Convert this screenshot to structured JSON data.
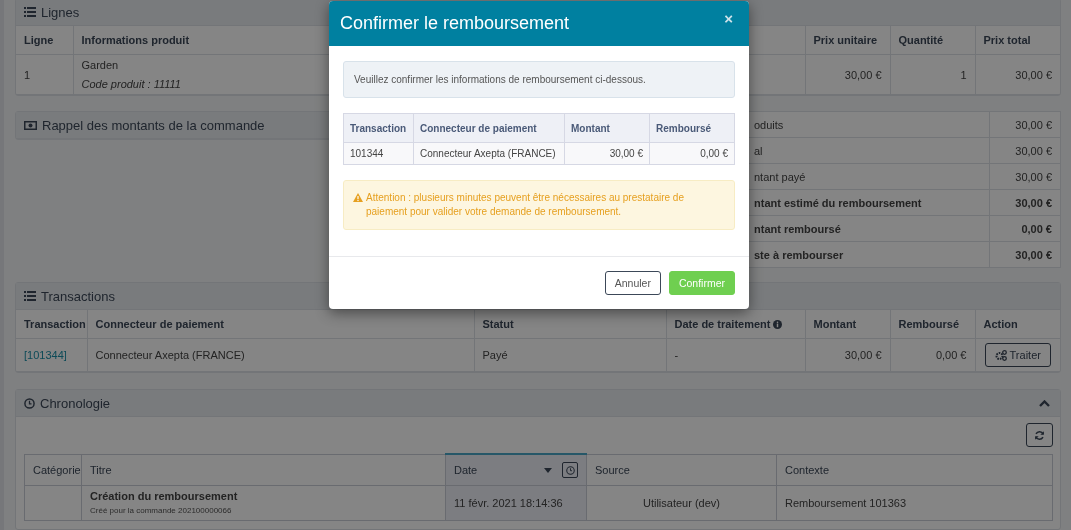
{
  "lignes": {
    "title": "Lignes",
    "columns": [
      {
        "label": "Ligne"
      },
      {
        "label": "Informations produit"
      },
      {
        "label": "Prix unitaire"
      },
      {
        "label": "Quantité"
      },
      {
        "label": "Prix total"
      }
    ],
    "rows": [
      {
        "line": "1",
        "product": "Garden",
        "code": "Code produit : 11111",
        "unit_price": "30,00 €",
        "quantity": "1",
        "total": "30,00 €"
      }
    ]
  },
  "rappel": {
    "title": "Rappel des montants de la commande",
    "rows": [
      {
        "label": "oduits",
        "value": "30,00 €",
        "bold": false
      },
      {
        "label": "al",
        "value": "30,00 €",
        "bold": false
      },
      {
        "label": "ntant payé",
        "value": "30,00 €",
        "bold": false
      },
      {
        "label": "ntant estimé du remboursement",
        "value": "30,00 €",
        "bold": true
      },
      {
        "label": "ntant remboursé",
        "value": "0,00 €",
        "bold": true
      },
      {
        "label": "ste à rembourser",
        "value": "30,00 €",
        "bold": true
      }
    ]
  },
  "transactions": {
    "title": "Transactions",
    "columns": [
      {
        "label": "Transaction",
        "info": false
      },
      {
        "label": "Connecteur de paiement",
        "info": false
      },
      {
        "label": "Statut",
        "info": false
      },
      {
        "label": "Date de traitement",
        "info": true
      },
      {
        "label": "Montant",
        "info": false
      },
      {
        "label": "Remboursé",
        "info": false
      },
      {
        "label": "Action",
        "info": false
      }
    ],
    "rows": [
      {
        "transaction": "[101344]",
        "connector": "Connecteur Axepta (FRANCE)",
        "status": "Payé",
        "date": "-",
        "amount": "30,00 €",
        "refunded": "0,00 €",
        "action": "Traiter"
      }
    ]
  },
  "chronologie": {
    "title": "Chronologie",
    "expanded": true,
    "columns": [
      {
        "label": "Catégorie",
        "sorted": false
      },
      {
        "label": "Titre",
        "sorted": false
      },
      {
        "label": "Date",
        "sorted": true
      },
      {
        "label": "Source",
        "sorted": false
      },
      {
        "label": "Contexte",
        "sorted": false
      }
    ],
    "rows": [
      {
        "title": "Création du remboursement",
        "subtitle": "Créé pour la commande 202100000066",
        "date": "11 févr. 2021 18:14:36",
        "source": "Utilisateur (dev)",
        "context": "Remboursement 101363"
      }
    ]
  },
  "modal": {
    "title": "Confirmer le remboursement",
    "close": "×",
    "message": "Veuillez confirmer les informations de remboursement ci-dessous.",
    "columns": [
      "Transaction",
      "Connecteur de paiement",
      "Montant",
      "Remboursé"
    ],
    "rows": [
      {
        "transaction": "101344",
        "connector": "Connecteur Axepta (FRANCE)",
        "amount": "30,00 €",
        "refunded": "0,00 €"
      }
    ],
    "warning": "Attention : plusieurs minutes peuvent être nécessaires au prestataire de paiement pour valider votre demande de remboursement.",
    "buttons": [
      {
        "label": "Annuler",
        "kind": "default"
      },
      {
        "label": "Confirmer",
        "kind": "primary"
      }
    ]
  }
}
